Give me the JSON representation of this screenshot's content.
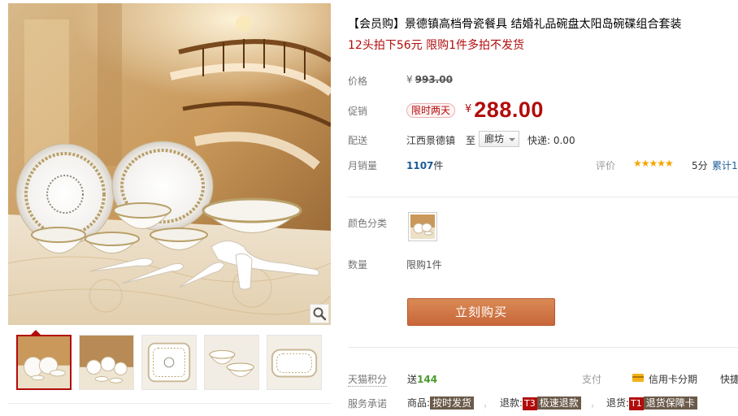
{
  "product": {
    "title": "【会员购】景德镇高档骨瓷餐具 结婚礼品碗盘太阳岛碗碟组合套装",
    "subtitle": "12头拍下56元 限购1件多拍不发货"
  },
  "price": {
    "label": "价格",
    "currency": "¥",
    "original": "993.00",
    "promo_label": "促销",
    "promo_badge": "限时两天",
    "current": "288.00"
  },
  "shipping": {
    "label": "配送",
    "from": "江西景德镇",
    "to_word": "至",
    "to_city": "廊坊",
    "express": "快递: 0.00"
  },
  "sales": {
    "label": "月销量",
    "count": "1107",
    "unit": "件",
    "rating_label": "评价",
    "stars": "★★★★★",
    "star_count": 5,
    "score": "5分",
    "total_reviews": "累计1"
  },
  "options": {
    "color_label": "颜色分类",
    "quantity_label": "数量",
    "quantity_value": "限购1件"
  },
  "actions": {
    "buy_label": "立刻购买"
  },
  "footer": {
    "points_label": "天猫积分",
    "points_prefix": "送",
    "points_value": "144",
    "pay_label": "支付",
    "credit_label": "信用卡分期",
    "express_pay": "快捷",
    "promise_label": "服务承诺",
    "promise_goods_prefix": "商品:",
    "promise_goods_tag": "按时发货",
    "promise_refund_prefix": "退款:",
    "promise_refund_code": "T3",
    "promise_refund_tag": "极速退款",
    "promise_return_prefix": "退货:",
    "promise_return_code": "T1",
    "promise_return_tag": "退货保障卡",
    "separator": "，"
  },
  "icons": {
    "zoom": "magnifier-icon",
    "credit": "credit-card-icon"
  },
  "colors": {
    "accent_red": "#b20c0c",
    "buy_button": "#cf7444",
    "star": "#f5a500",
    "link_blue": "#1b5c99"
  }
}
